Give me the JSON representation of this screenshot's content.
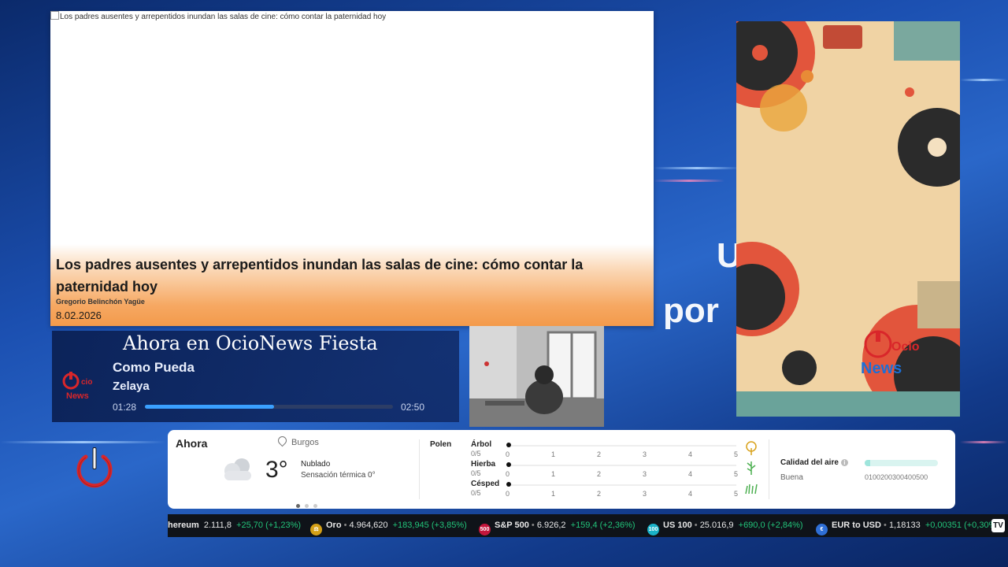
{
  "background": {
    "overlay_words": [
      "U",
      "por",
      "News"
    ]
  },
  "news_card": {
    "image_alt": "Los padres ausentes y arrepentidos inundan las salas de cine: cómo contar la paternidad hoy",
    "title": "Los padres ausentes y arrepentidos inundan las salas de cine: cómo contar la paternidad hoy",
    "author": "Gregorio Belinchón Yagüe",
    "date": "8.02.2026"
  },
  "now_playing": {
    "heading": "Ahora en OcioNews Fiesta",
    "song": "Como Pueda",
    "artist": "Zelaya",
    "current_time": "01:28",
    "total_time": "02:50",
    "progress": 0.52,
    "accent": "#3aa0ff"
  },
  "poster": {
    "logo_top": "Ocio",
    "logo_bottom": "News"
  },
  "weather": {
    "now_label": "Ahora",
    "location": "Burgos",
    "temperature": "3°",
    "condition": "Nublado",
    "feels_like": "Sensación térmica 0°",
    "pollen_title": "Polen",
    "pollen": [
      {
        "name": "Árbol",
        "value": "0/5",
        "icon": "tree-icon"
      },
      {
        "name": "Hierba",
        "value": "0/5",
        "icon": "grass-icon"
      },
      {
        "name": "Césped",
        "value": "0/5",
        "icon": "lawn-icon"
      }
    ],
    "pollen_scale": [
      "0",
      "1",
      "2",
      "3",
      "4",
      "5"
    ],
    "air_quality_title": "Calidad del aire",
    "air_quality_state": "Buena",
    "air_quality_scale": "0100200300400500"
  },
  "ticker": [
    {
      "name": "hereum",
      "value": "2.111,8",
      "change": "+25,70 (+1,23%)",
      "icon": "ethereum-icon",
      "color": "#627eea"
    },
    {
      "name": "Oro",
      "value": "4.964,620",
      "change": "+183,945 (+3,85%)",
      "icon": "gold-icon",
      "color": "#d4a017"
    },
    {
      "name": "S&P 500",
      "value": "6.926,2",
      "change": "+159,4 (+2,36%)",
      "icon": "sp500-icon",
      "color": "#c4163c",
      "badge": "500"
    },
    {
      "name": "US 100",
      "value": "25.016,9",
      "change": "+690,0 (+2,84%)",
      "icon": "us100-icon",
      "color": "#1ab2c8",
      "badge": "100"
    },
    {
      "name": "EUR to USD",
      "value": "1,18133",
      "change": "+0,00351 (+0,30%)",
      "icon": "eur-usd-icon",
      "color": "#2f6fd6"
    }
  ],
  "ticker_logo": "TV"
}
